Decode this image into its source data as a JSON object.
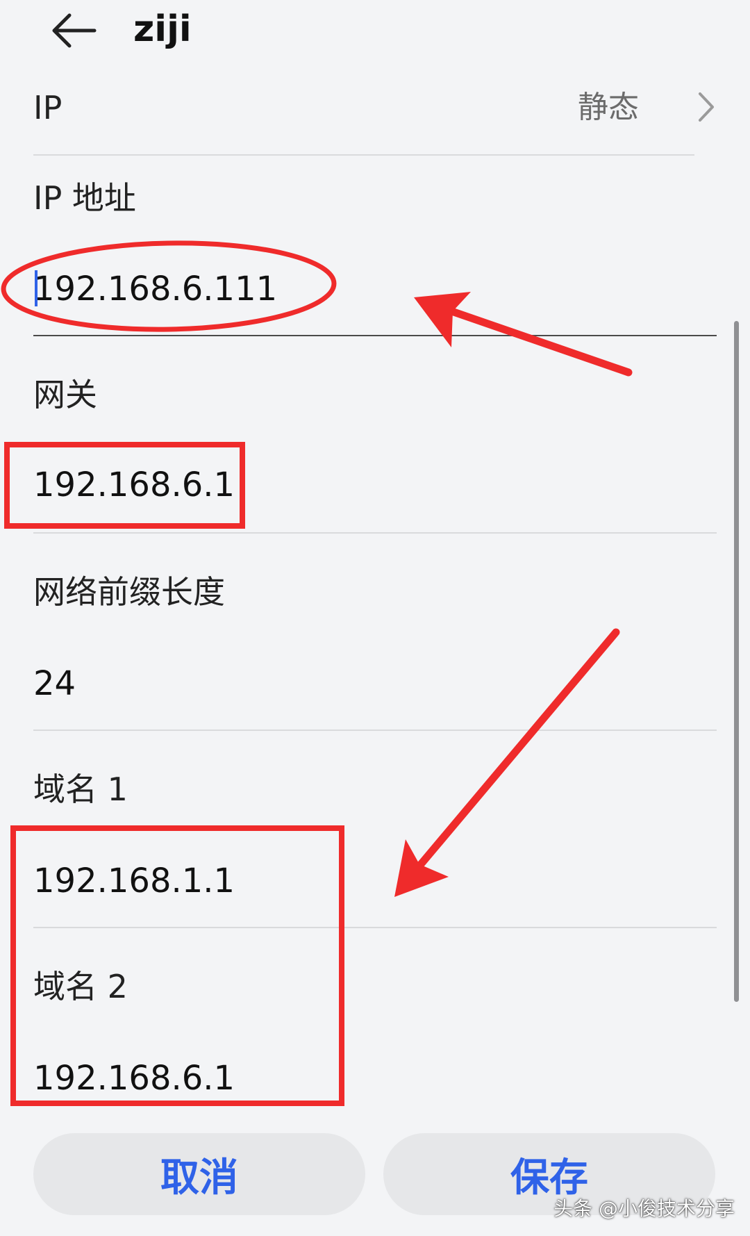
{
  "header": {
    "title": "ziji",
    "back_icon": "arrow-left-icon"
  },
  "ip_mode": {
    "label": "IP",
    "value": "静态",
    "icon": "chevron-right-icon"
  },
  "ip_address": {
    "label": "IP 地址",
    "value": "192.168.6.111"
  },
  "gateway": {
    "label": "网关",
    "value": "192.168.6.1"
  },
  "prefix_length": {
    "label": "网络前缀长度",
    "value": "24"
  },
  "dns1": {
    "label": "域名 1",
    "value": "192.168.1.1"
  },
  "dns2": {
    "label": "域名 2",
    "value": "192.168.6.1"
  },
  "buttons": {
    "cancel": "取消",
    "save": "保存"
  },
  "watermark": "头条 @小俊技术分享",
  "colors": {
    "accent": "#2f62e8",
    "annotation": "#ef2b2b",
    "background": "#f3f4f6"
  }
}
